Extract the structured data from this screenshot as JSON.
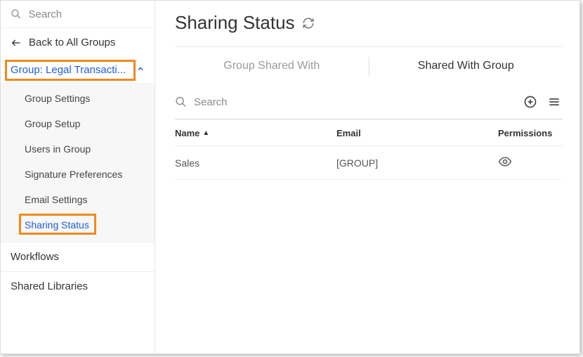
{
  "sidebar": {
    "search_placeholder": "Search",
    "back_label": "Back to All Groups",
    "group_label": "Group: Legal Transacti...",
    "sub_items": [
      {
        "label": "Group Settings"
      },
      {
        "label": "Group Setup"
      },
      {
        "label": "Users in Group"
      },
      {
        "label": "Signature Preferences"
      },
      {
        "label": "Email Settings"
      },
      {
        "label": "Sharing Status"
      }
    ],
    "items_after": [
      {
        "label": "Workflows"
      },
      {
        "label": "Shared Libraries"
      }
    ]
  },
  "main": {
    "title": "Sharing Status",
    "tabs": [
      {
        "label": "Group Shared With"
      },
      {
        "label": "Shared With Group"
      }
    ],
    "active_tab_index": 1,
    "search_placeholder": "Search",
    "columns": {
      "name": "Name",
      "email": "Email",
      "permissions": "Permissions"
    },
    "rows": [
      {
        "name": "Sales",
        "email": "[GROUP]",
        "permission_icon": "eye"
      }
    ]
  }
}
